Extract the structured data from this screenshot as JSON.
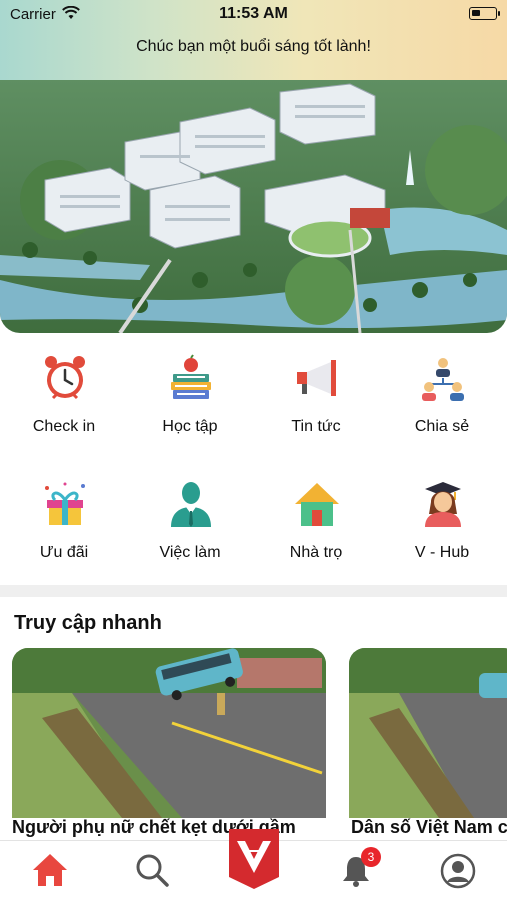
{
  "status_bar": {
    "carrier": "Carrier",
    "time": "11:53 AM"
  },
  "greeting": "Chúc bạn một buổi sáng tốt lành!",
  "menu": [
    {
      "label": "Check in",
      "icon": "alarm-clock-icon"
    },
    {
      "label": "Học tập",
      "icon": "books-apple-icon"
    },
    {
      "label": "Tin tức",
      "icon": "megaphone-icon"
    },
    {
      "label": "Chia sẻ",
      "icon": "people-share-icon"
    },
    {
      "label": "Ưu đãi",
      "icon": "gift-box-icon"
    },
    {
      "label": "Việc làm",
      "icon": "businessman-icon"
    },
    {
      "label": "Nhà trọ",
      "icon": "house-icon"
    },
    {
      "label": "V - Hub",
      "icon": "graduate-icon"
    }
  ],
  "quick_access": {
    "title": "Truy cập nhanh",
    "cards": [
      {
        "title": "Người phụ nữ chết kẹt dưới gầm"
      },
      {
        "title": "Dân số Việt Nam c"
      }
    ]
  },
  "tab_bar": {
    "items": [
      "home-icon",
      "search-icon",
      "app-logo-icon",
      "bell-icon",
      "profile-icon"
    ],
    "notification_count": "3",
    "active_color": "#e8473f"
  }
}
